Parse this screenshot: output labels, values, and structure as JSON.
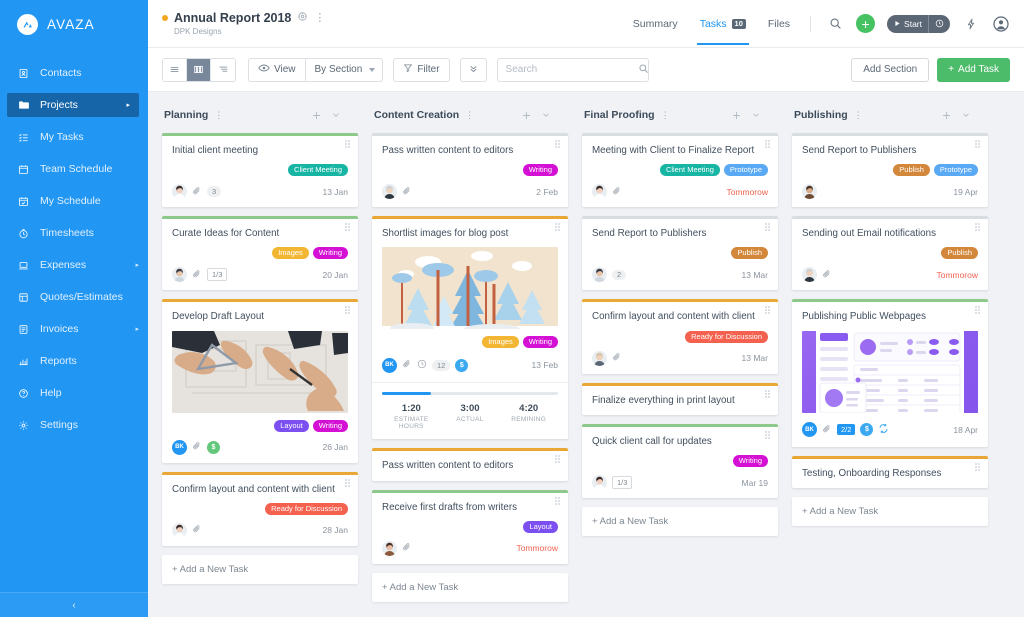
{
  "brand": {
    "name": "AVAZA",
    "color": "#2196f3"
  },
  "sidebar": {
    "items": [
      {
        "label": "Contacts",
        "icon": "contacts-icon",
        "arrow": false
      },
      {
        "label": "Projects",
        "icon": "projects-icon",
        "arrow": true,
        "active": true
      },
      {
        "label": "My Tasks",
        "icon": "my-tasks-icon",
        "arrow": false
      },
      {
        "label": "Team Schedule",
        "icon": "team-schedule-icon",
        "arrow": false
      },
      {
        "label": "My Schedule",
        "icon": "my-schedule-icon",
        "arrow": false
      },
      {
        "label": "Timesheets",
        "icon": "timesheets-icon",
        "arrow": false
      },
      {
        "label": "Expenses",
        "icon": "expenses-icon",
        "arrow": true
      },
      {
        "label": "Quotes/Estimates",
        "icon": "quotes-icon",
        "arrow": false
      },
      {
        "label": "Invoices",
        "icon": "invoices-icon",
        "arrow": true
      },
      {
        "label": "Reports",
        "icon": "reports-icon",
        "arrow": false
      },
      {
        "label": "Help",
        "icon": "help-icon",
        "arrow": false
      },
      {
        "label": "Settings",
        "icon": "settings-icon",
        "arrow": false
      }
    ],
    "collapse_label": "‹"
  },
  "header": {
    "project_title": "Annual Report 2018",
    "project_subtitle": "DPK Designs",
    "nav": [
      {
        "label": "Summary",
        "badge": "",
        "active": false
      },
      {
        "label": "Tasks",
        "badge": "10",
        "active": true
      },
      {
        "label": "Files",
        "badge": "",
        "active": false
      }
    ],
    "start_label": "Start",
    "plus_label": "+"
  },
  "toolbar": {
    "views": [
      "list-view-icon",
      "board-view-icon",
      "outline-view-icon"
    ],
    "active_view_index": 1,
    "view_label": "View",
    "group_by_label": "By Section",
    "filter_label": "Filter",
    "search_placeholder": "Search",
    "search_value": "",
    "add_section_label": "Add Section",
    "add_task_label": "Add Task"
  },
  "board": {
    "add_task_label": "+ Add a New Task",
    "columns": [
      {
        "title": "Planning",
        "cards": [
          {
            "title": "Initial client meeting",
            "strip": "#8cc98b",
            "tags": [
              {
                "label": "Client Meeting",
                "color": "#17b5a3"
              }
            ],
            "avatar": "woman-1",
            "clip": true,
            "count_pill": "3",
            "date": "13 Jan",
            "due": false
          },
          {
            "title": "Curate Ideas for Content",
            "strip": "#8cc98b",
            "tags": [
              {
                "label": "Images",
                "color": "#f2b633"
              },
              {
                "label": "Writing",
                "color": "#d410d4"
              }
            ],
            "avatar": "man-1",
            "clip": true,
            "count_box": "1/3",
            "date": "20 Jan",
            "due": false
          },
          {
            "title": "Develop Draft Layout",
            "strip": "#e9a836",
            "image": "blueprint",
            "tags": [
              {
                "label": "Layout",
                "color": "#7b4ff0"
              },
              {
                "label": "Writing",
                "color": "#d410d4"
              }
            ],
            "avatar_initials": "BK",
            "clip": true,
            "badge_circle": {
              "label": "$",
              "color": "#63c77c"
            },
            "date": "26 Jan",
            "due": false
          },
          {
            "title": "Confirm layout and content with client",
            "strip": "#e9a836",
            "tags": [
              {
                "label": "Ready for Discussion",
                "color": "#f4614f"
              }
            ],
            "avatar": "woman-1",
            "clip": true,
            "date": "28 Jan",
            "due": false
          }
        ]
      },
      {
        "title": "Content Creation",
        "cards": [
          {
            "title": "Pass written content to editors",
            "strip": "#d8dde1",
            "tags": [
              {
                "label": "Writing",
                "color": "#d410d4"
              }
            ],
            "avatar": "man-2",
            "clip": true,
            "date": "2 Feb",
            "due": false
          },
          {
            "title": "Shortlist images for blog post",
            "strip": "#e9a836",
            "image": "forest",
            "tags": [
              {
                "label": "Images",
                "color": "#f2b633"
              },
              {
                "label": "Writing",
                "color": "#d410d4"
              }
            ],
            "avatar_initials": "BK",
            "clip": true,
            "clock": true,
            "count_pill": "12",
            "badge_circle": {
              "label": "$",
              "color": "#3aa9f0"
            },
            "date": "13 Feb",
            "due": false,
            "time": {
              "progress": 28,
              "cells": [
                {
                  "value": "1:20",
                  "label": "ESTIMATE HOURS"
                },
                {
                  "value": "3:00",
                  "label": "ACTUAL"
                },
                {
                  "value": "4:20",
                  "label": "REMINING"
                }
              ]
            }
          },
          {
            "title": "Pass written content to editors",
            "strip": "#e9a836",
            "tags": [],
            "date": "",
            "due": false
          },
          {
            "title": "Receive first drafts from writers",
            "strip": "#8cc98b",
            "tags": [
              {
                "label": "Layout",
                "color": "#7b4ff0"
              }
            ],
            "avatar": "woman-2",
            "clip": true,
            "date": "Tommorow",
            "due": true
          }
        ]
      },
      {
        "title": "Final Proofing",
        "cards": [
          {
            "title": "Meeting with Client to Finalize Report",
            "strip": "#d8dde1",
            "tags": [
              {
                "label": "Client Meeting",
                "color": "#17b5a3"
              },
              {
                "label": "Prototype",
                "color": "#5aa9f5"
              }
            ],
            "avatar": "woman-1",
            "clip": true,
            "date": "Tommorow",
            "due": true
          },
          {
            "title": "Send Report to Publishers",
            "strip": "#d8dde1",
            "tags": [
              {
                "label": "Publish",
                "color": "#d2873a"
              }
            ],
            "avatar": "man-1",
            "count_pill": "2",
            "date": "13 Mar",
            "due": false
          },
          {
            "title": "Confirm layout and content with client",
            "strip": "#e9a836",
            "tags": [
              {
                "label": "Ready for Discussion",
                "color": "#f4614f"
              }
            ],
            "avatar": "man-3",
            "clip": true,
            "date": "13 Mar",
            "due": false
          },
          {
            "title": "Finalize everything in print layout",
            "strip": "#e9a836",
            "tags": [],
            "date": "",
            "due": false
          },
          {
            "title": "Quick client call for updates",
            "strip": "#8cc98b",
            "tags": [
              {
                "label": "Writing",
                "color": "#d410d4"
              }
            ],
            "avatar": "woman-1",
            "count_box": "1/3",
            "date": "Mar 19",
            "due": false
          }
        ]
      },
      {
        "title": "Publishing",
        "cards": [
          {
            "title": "Send Report to Publishers",
            "strip": "#d8dde1",
            "tags": [
              {
                "label": "Publish",
                "color": "#d2873a"
              },
              {
                "label": "Prototype",
                "color": "#5aa9f5"
              }
            ],
            "avatar": "man-4",
            "date": "19 Apr",
            "due": false
          },
          {
            "title": "Sending out Email notifications",
            "strip": "#d8dde1",
            "tags": [
              {
                "label": "Publish",
                "color": "#d2873a"
              }
            ],
            "avatar": "man-2",
            "clip": true,
            "date": "Tommorow",
            "due": true
          },
          {
            "title": "Publishing Public Webpages",
            "strip": "#8cc98b",
            "image": "dashboard",
            "avatar_initials": "BK",
            "clip": true,
            "badge_sq": "2/2",
            "badge_circle": {
              "label": "$",
              "color": "#3aa9f0"
            },
            "repeat": true,
            "date": "18 Apr",
            "due": false,
            "tags": []
          },
          {
            "title": "Testing, Onboarding Responses",
            "strip": "#e9a836",
            "tags": [],
            "date": "",
            "due": false
          }
        ]
      }
    ]
  }
}
